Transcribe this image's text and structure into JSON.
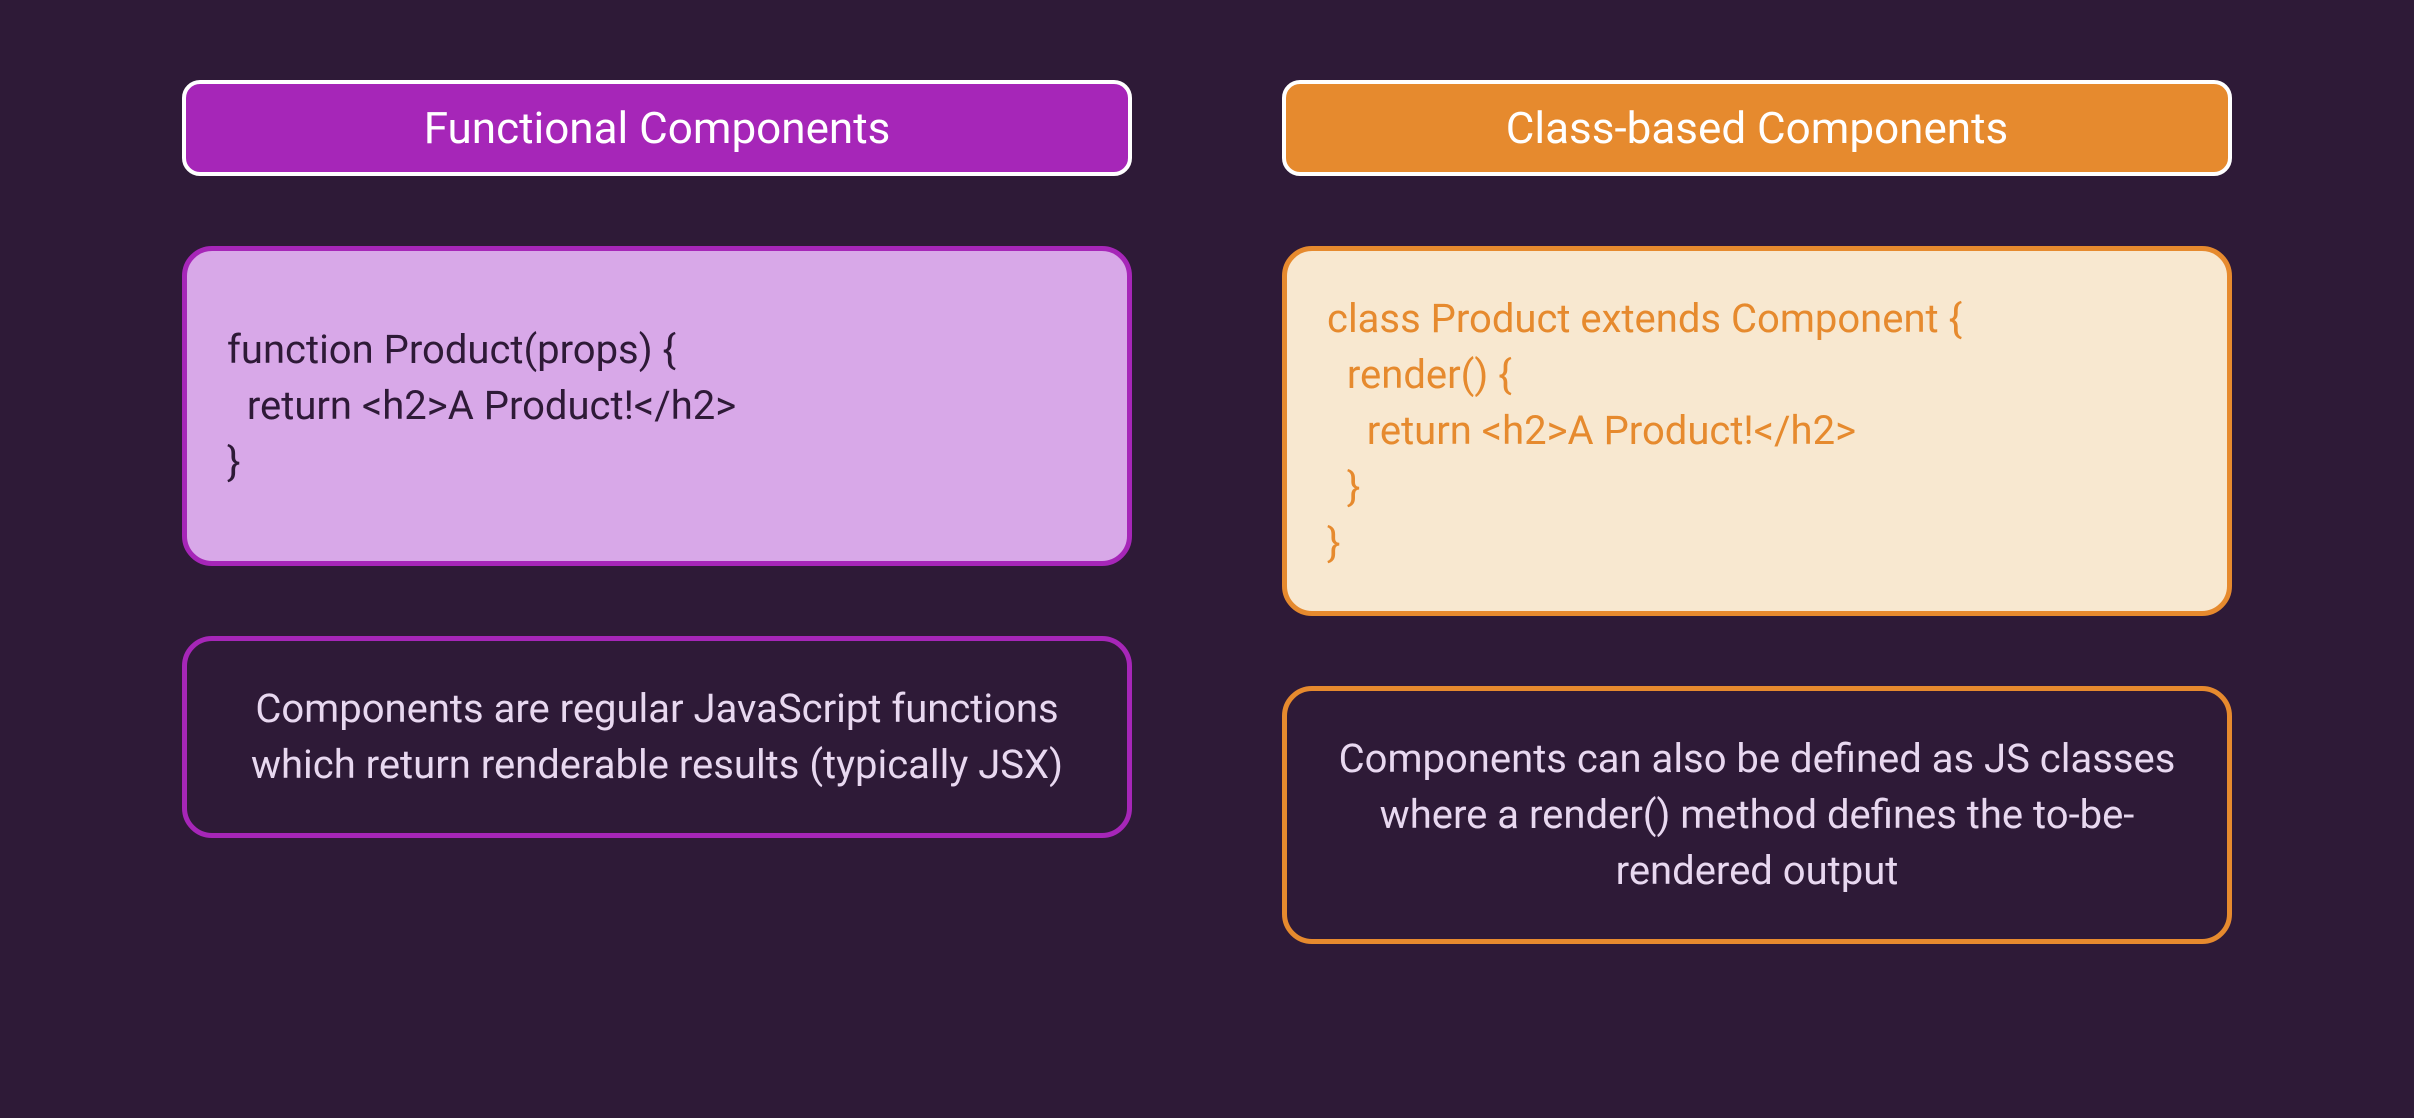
{
  "left": {
    "title": "Functional Components",
    "code": "function Product(props) {\n  return <h2>A Product!</h2>\n}",
    "description": "Components are regular JavaScript functions which return renderable results (typically JSX)"
  },
  "right": {
    "title": "Class-based Components",
    "code": "class Product extends Component {\n  render() {\n    return <h2>A Product!</h2>\n  }\n}",
    "description": "Components can also be defined as JS classes where a render() method defines the to-be-rendered output"
  }
}
